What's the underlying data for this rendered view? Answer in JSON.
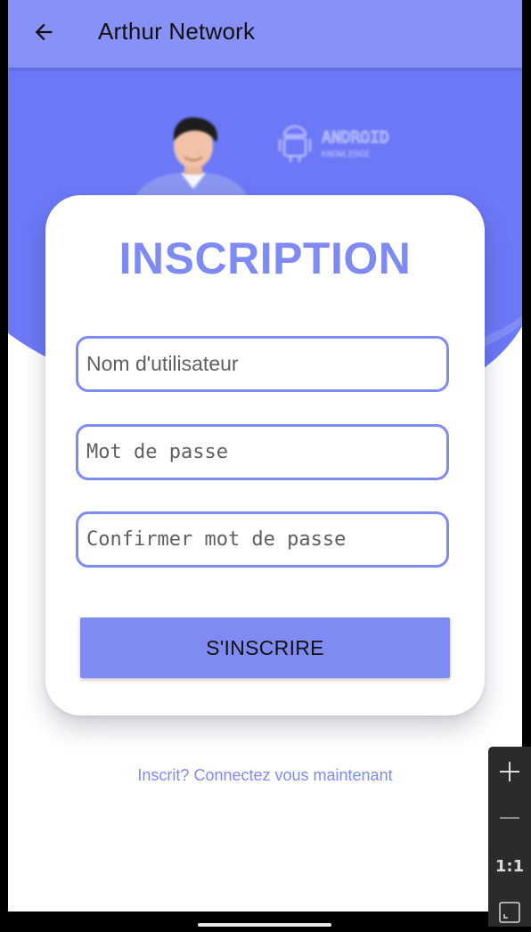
{
  "appbar": {
    "title": "Arthur Network",
    "back_icon": "arrow-left-icon"
  },
  "hero": {
    "logo_text_line1": "ANDROID",
    "logo_text_line2": "KNOWLEDGE"
  },
  "form": {
    "title": "INSCRIPTION",
    "username_placeholder": "Nom d'utilisateur",
    "password_placeholder": "Mot de passe",
    "confirm_placeholder": "Confirmer mot de passe",
    "submit_label": "S'INSCRIRE"
  },
  "footer": {
    "login_link": "Inscrit? Connectez vous maintenant"
  },
  "zoom_controls": {
    "zoom_in_icon": "plus-icon",
    "zoom_out_icon": "minus-icon",
    "reset_label": "1:1",
    "fit_icon": "fit-screen-icon"
  },
  "colors": {
    "primary": "#7f8bf3",
    "appbar": "#8891f8",
    "hero": "#6c78f6",
    "background": "#ffffff"
  }
}
